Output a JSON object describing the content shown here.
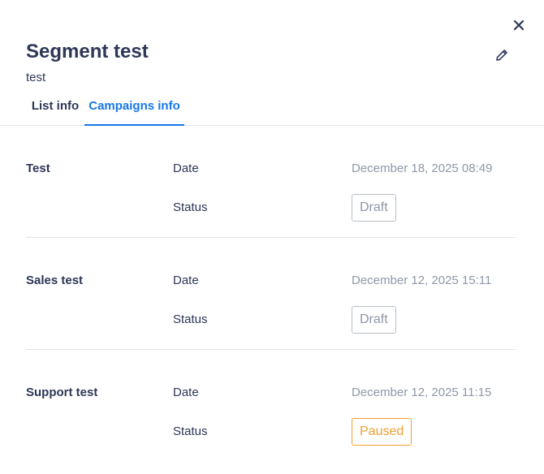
{
  "header": {
    "title": "Segment test",
    "subtitle": "test"
  },
  "icons": {
    "close": "close-icon",
    "edit": "pencil-icon"
  },
  "tabs": [
    {
      "label": "List info",
      "active": false
    },
    {
      "label": "Campaigns info",
      "active": true
    }
  ],
  "labels": {
    "date": "Date",
    "status": "Status"
  },
  "campaigns": [
    {
      "name": "Test",
      "date": "December 18, 2025 08:49",
      "status": "Draft"
    },
    {
      "name": "Sales test",
      "date": "December 12, 2025 15:11",
      "status": "Draft"
    },
    {
      "name": "Support test",
      "date": "December 12, 2025 11:15",
      "status": "Paused"
    }
  ],
  "colors": {
    "title": "#2d3757",
    "accent": "#1677e8",
    "muted": "#8f97a8",
    "draft_border": "#b8bec9",
    "paused": "#f0a030",
    "divider": "#dfe2e8"
  }
}
